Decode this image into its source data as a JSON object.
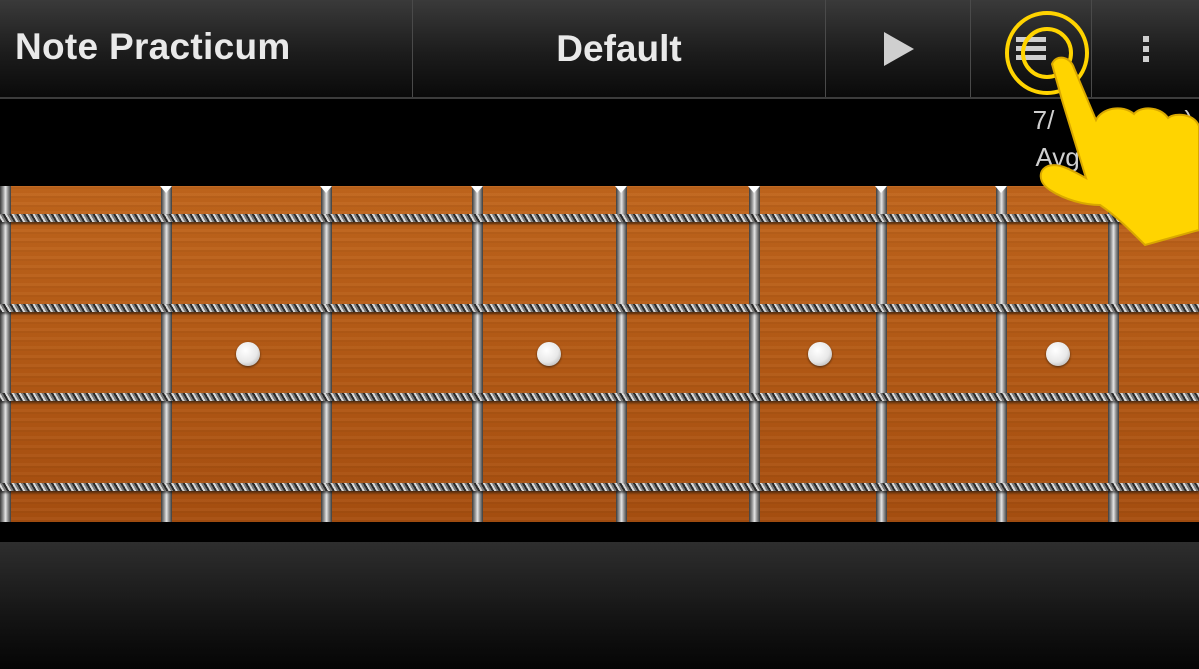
{
  "action_bar": {
    "title": "Note Practicum",
    "mode": "Default",
    "play_icon": "play-icon",
    "menu_icon": "menu-icon",
    "overflow_icon": "overflow-menu-icon"
  },
  "stats": {
    "score_partial": "7/",
    "score_partial_suffix": ")",
    "avg_time_partial": "Avg ti"
  },
  "fretboard": {
    "frets_visible": 9,
    "strings": 4,
    "inlay_markers": 4
  },
  "colors": {
    "highlight": "#FFD400",
    "fretboard_wood": "#B45A15",
    "text": "#E9E9E9"
  }
}
